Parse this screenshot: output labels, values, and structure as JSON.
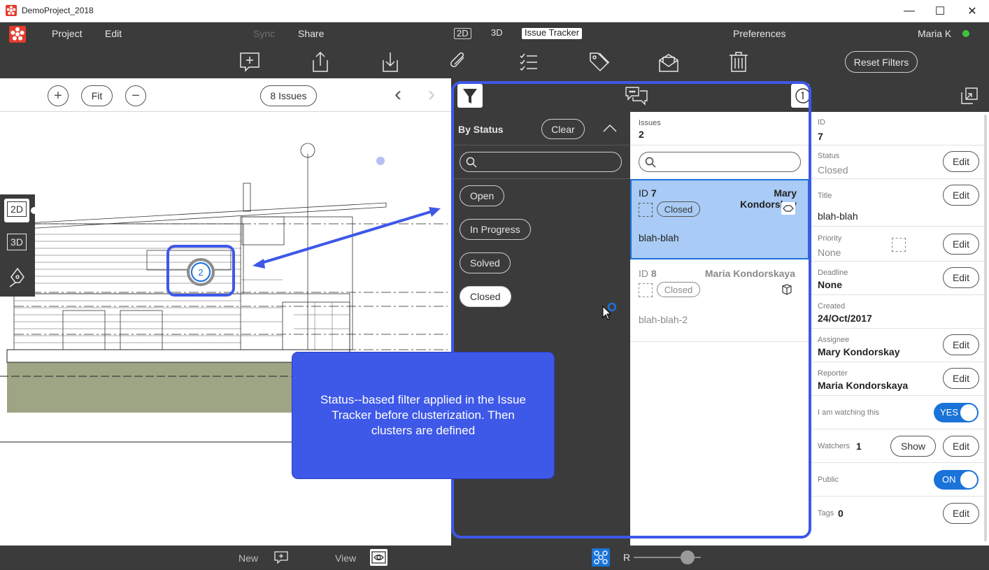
{
  "window": {
    "title": "DemoProject_2018",
    "minimize": "—",
    "maximize": "☐",
    "close": "✕"
  },
  "menu": {
    "project": "Project",
    "edit": "Edit",
    "sync": "Sync",
    "share": "Share",
    "mode_2d": "2D",
    "mode_3d": "3D",
    "issue_tracker": "Issue Tracker",
    "preferences": "Preferences",
    "user": "Maria K",
    "user_status_color": "#3cc43c"
  },
  "toolbar": {
    "icons": [
      "add-issue-icon",
      "export-icon",
      "import-icon",
      "attach-icon",
      "checklist-icon",
      "tag-icon",
      "mail-icon",
      "trash-icon"
    ],
    "reset_filters": "Reset Filters"
  },
  "view": {
    "zoom_in": "+",
    "fit": "Fit",
    "zoom_out": "−",
    "issues_count": "8 Issues",
    "prev": "‹",
    "next": "›"
  },
  "side_tools": {
    "mode_2d": "2D",
    "mode_3d": "3D"
  },
  "marker": {
    "count": "2"
  },
  "filter": {
    "heading": "By Status",
    "clear": "Clear",
    "search_placeholder": "",
    "statuses": [
      {
        "label": "Open",
        "selected": false
      },
      {
        "label": "In Progress",
        "selected": false
      },
      {
        "label": "Solved",
        "selected": false
      },
      {
        "label": "Closed",
        "selected": true
      }
    ]
  },
  "issues": {
    "heading": "Issues",
    "count": "2",
    "search_placeholder": "",
    "items": [
      {
        "id_label": "ID",
        "id": "7",
        "author": "Mary Kondorskay",
        "status": "Closed",
        "title": "blah-blah",
        "selected": true
      },
      {
        "id_label": "ID",
        "id": "8",
        "author": "Maria Kondorskaya",
        "status": "Closed",
        "title": "blah-blah-2",
        "selected": false
      }
    ]
  },
  "details": {
    "id_label": "ID",
    "id": "7",
    "status_label": "Status",
    "status": "Closed",
    "title_label": "Title",
    "title": "blah-blah",
    "priority_label": "Priority",
    "priority": "None",
    "deadline_label": "Deadline",
    "deadline": "None",
    "created_label": "Created",
    "created": "24/Oct/2017",
    "assignee_label": "Assignee",
    "assignee": "Mary Kondorskay",
    "reporter_label": "Reporter",
    "reporter": "Maria Kondorskaya",
    "watching_label": "I am watching this",
    "watching": "YES",
    "watchers_label": "Watchers",
    "watchers": "1",
    "show": "Show",
    "public_label": "Public",
    "public": "ON",
    "tags_label": "Tags",
    "tags": "0",
    "edit": "Edit"
  },
  "bottom": {
    "new": "New",
    "view": "View",
    "r_label": "R",
    "slider_value": 0.8
  },
  "callout": {
    "text": "Status--based filter applied in the Issue Tracker before clusterization. Then clusters are defined"
  },
  "colors": {
    "accent": "#3e58e8",
    "selection": "#a9cbf5",
    "toggle": "#1a73d9",
    "dark": "#3b3b3b",
    "logo": "#e43b2c"
  }
}
